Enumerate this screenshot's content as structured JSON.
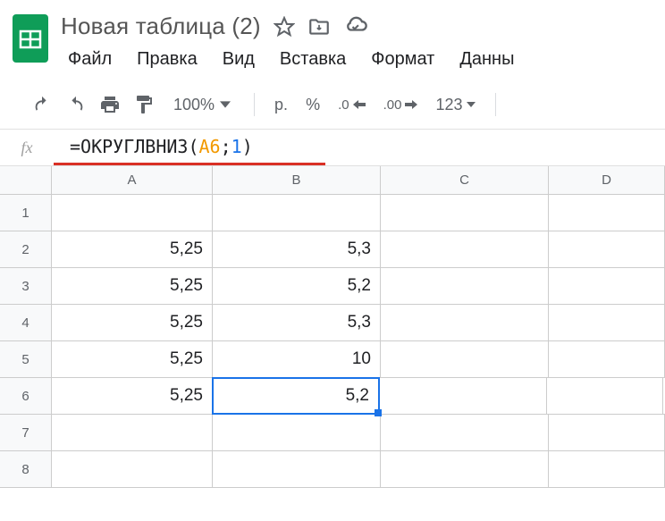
{
  "title": "Новая таблица (2)",
  "menubar": [
    "Файл",
    "Правка",
    "Вид",
    "Вставка",
    "Формат",
    "Данны"
  ],
  "toolbar": {
    "zoom": "100%",
    "currency": "р.",
    "percent": "%",
    "dec_dec": ".0",
    "inc_dec": ".00",
    "num_fmt": "123"
  },
  "formula": {
    "prefix": "=",
    "func": "ОКРУГЛВНИЗ",
    "open": "(",
    "ref": "A6",
    "sep": ";",
    "arg": "1",
    "close": ")"
  },
  "columns": [
    "A",
    "B",
    "C",
    "D"
  ],
  "rows": [
    {
      "n": "1",
      "A": "",
      "B": ""
    },
    {
      "n": "2",
      "A": "5,25",
      "B": "5,3"
    },
    {
      "n": "3",
      "A": "5,25",
      "B": "5,2"
    },
    {
      "n": "4",
      "A": "5,25",
      "B": "5,3"
    },
    {
      "n": "5",
      "A": "5,25",
      "B": "10"
    },
    {
      "n": "6",
      "A": "5,25",
      "B": "5,2"
    },
    {
      "n": "7",
      "A": "",
      "B": ""
    },
    {
      "n": "8",
      "A": "",
      "B": ""
    }
  ],
  "active_cell": {
    "row": 6,
    "col": "B"
  }
}
